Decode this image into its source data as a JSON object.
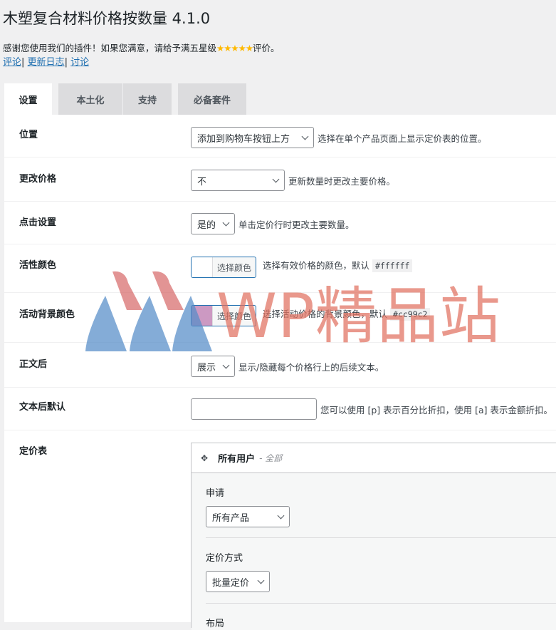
{
  "header": {
    "title": "木塑复合材料价格按数量 4.1.0",
    "thanks_prefix": "感谢您使用我们的插件！如果您满意，请给予满五星级",
    "stars": "★★★★★",
    "thanks_suffix": "评价。",
    "links": [
      {
        "label": "评论"
      },
      {
        "label": "更新日志"
      },
      {
        "label": "讨论"
      }
    ],
    "separator": "|"
  },
  "tabs": [
    {
      "label": "设置",
      "active": true
    },
    {
      "label": "本土化",
      "active": false
    },
    {
      "label": "支持",
      "active": false
    },
    {
      "label": "必备套件",
      "active": false
    }
  ],
  "settings": {
    "position": {
      "label": "位置",
      "value": "添加到购物车按钮上方",
      "desc": "选择在单个产品页面上显示定价表的位置。"
    },
    "change_price": {
      "label": "更改价格",
      "value": "不",
      "desc": "更新数量时更改主要价格。"
    },
    "click_setting": {
      "label": "点击设置",
      "value": "是的",
      "desc": "单击定价行时更改主要数量。"
    },
    "active_color": {
      "label": "活性颜色",
      "button": "选择颜色",
      "desc": "选择有效价格的颜色，默认",
      "default": "#ffffff",
      "swatch": "#ffffff"
    },
    "active_bg_color": {
      "label": "活动背景颜色",
      "button": "选择颜色",
      "desc": "选择活动价格的背景颜色，默认",
      "default": "#cc99c2",
      "swatch": "#cc99c2"
    },
    "after_text": {
      "label": "正文后",
      "value": "展示",
      "desc": "显示/隐藏每个价格行上的后续文本。"
    },
    "after_text_default": {
      "label": "文本后默认",
      "value": "",
      "desc": "您可以使用 [p] 表示百分比折扣，使用 [a] 表示金额折扣。"
    },
    "pricing_table": {
      "label": "定价表",
      "rule_title": "所有用户",
      "rule_sub": "- 全部",
      "apply_label": "申请",
      "apply_value": "所有产品",
      "method_label": "定价方式",
      "method_value": "批量定价",
      "layout_label": "布局"
    }
  },
  "watermark": {
    "text": "WP精品站"
  },
  "colors": {
    "accent": "#2271b1",
    "stars": "#ffb900",
    "background": "#f0f0f1"
  }
}
